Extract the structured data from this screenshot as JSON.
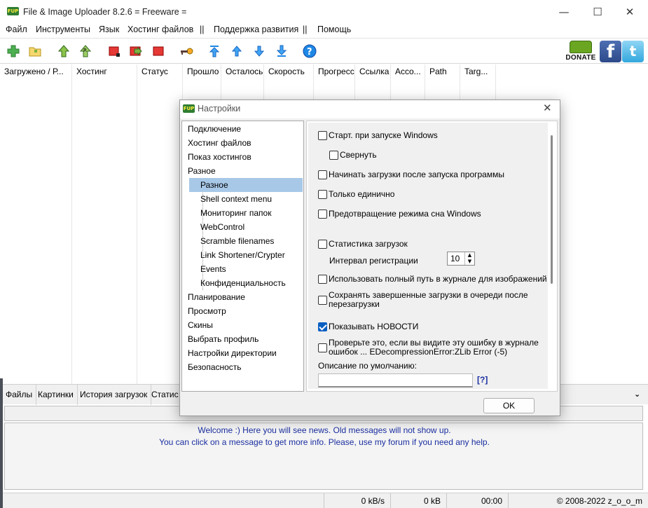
{
  "window": {
    "title": "File & Image Uploader 8.2.6  = Freeware =",
    "app_icon_text": "FUP",
    "minimize": "—",
    "maximize": "☐",
    "close": "✕"
  },
  "menu": {
    "items": [
      "Файл",
      "Инструменты",
      "Язык",
      "Хостинг файлов",
      "||",
      "Поддержка развития",
      "||",
      "Помощь"
    ]
  },
  "toolbar": {
    "icons": [
      "add-icon",
      "open-folder-icon",
      "upload-icon",
      "upload-all-icon",
      "stop-icon",
      "move-icon",
      "stop-all-icon",
      "key-icon",
      "move-top-icon",
      "move-up-icon",
      "move-down-icon",
      "move-bottom-icon",
      "help-icon"
    ],
    "donate_label": "DONATE",
    "facebook_label": "f",
    "twitter_label": "t"
  },
  "columns": [
    "Загружено / Р...",
    "Хостинг",
    "Статус",
    "Прошло",
    "Осталось",
    "Скорость",
    "Прогресс",
    "Ссылка",
    "Acco...",
    "Path",
    "Targ..."
  ],
  "bottom_tabs": [
    "Файлы",
    "Картинки",
    "История загрузок",
    "Статис"
  ],
  "news": {
    "line1": "Welcome :) Here you will see news. Old messages will not show up.",
    "line2": "You can click on a message to get more info. Please, use my forum if you need any help."
  },
  "status_bar": {
    "speed": "0 kB/s",
    "size": "0 kB",
    "time": "00:00",
    "copyright": "© 2008-2022 z_o_o_m"
  },
  "dialog": {
    "title": "Настройки",
    "close": "✕",
    "tree": [
      {
        "label": "Подключение",
        "child": false,
        "selected": false
      },
      {
        "label": "Хостинг файлов",
        "child": false,
        "selected": false
      },
      {
        "label": "Показ хостингов",
        "child": false,
        "selected": false
      },
      {
        "label": "Разное",
        "child": false,
        "selected": false
      },
      {
        "label": "Разное",
        "child": true,
        "selected": true
      },
      {
        "label": "Shell context menu",
        "child": true,
        "selected": false
      },
      {
        "label": "Мониторинг папок",
        "child": true,
        "selected": false
      },
      {
        "label": "WebControl",
        "child": true,
        "selected": false
      },
      {
        "label": "Scramble filenames",
        "child": true,
        "selected": false
      },
      {
        "label": "Link Shortener/Crypter",
        "child": true,
        "selected": false
      },
      {
        "label": "Events",
        "child": true,
        "selected": false
      },
      {
        "label": "Конфиденциальность",
        "child": true,
        "selected": false
      },
      {
        "label": "Планирование",
        "child": false,
        "selected": false
      },
      {
        "label": "Просмотр",
        "child": false,
        "selected": false
      },
      {
        "label": "Скины",
        "child": false,
        "selected": false
      },
      {
        "label": "Выбрать профиль",
        "child": false,
        "selected": false
      },
      {
        "label": "Настройки директории",
        "child": false,
        "selected": false
      },
      {
        "label": "Безопасность",
        "child": false,
        "selected": false
      }
    ],
    "options": {
      "start_with_windows": {
        "label": "Старт. при запуске Windows",
        "checked": false
      },
      "minimize": {
        "label": "Свернуть",
        "checked": false
      },
      "start_uploads_on_launch": {
        "label": "Начинать загрузки после запуска программы",
        "checked": false
      },
      "single_instance": {
        "label": "Только единично",
        "checked": false
      },
      "prevent_sleep": {
        "label": "Предотвращение режима сна Windows",
        "checked": false
      },
      "upload_stats": {
        "label": "Статистика загрузок",
        "checked": false
      },
      "log_full_path": {
        "label": "Использовать полный путь в журнале для изображений",
        "checked": false
      },
      "keep_completed_line1": "Сохранять завершенные загрузки в очереди после",
      "keep_completed_line2": "перезагрузки",
      "keep_completed_checked": false,
      "show_news": {
        "label": "Показывать НОВОСТИ",
        "checked": true
      },
      "check_error_line1": "Проверьте это, если вы видите эту ошибку в журнале",
      "check_error_line2": "ошибок ...  EDecompressionError:ZLib Error (-5)",
      "check_error_checked": false
    },
    "interval_label": "Интервал регистрации",
    "interval_value": "10",
    "default_description_label": "Описание по умолчанию:",
    "default_description_value": "",
    "help_link": "[?]",
    "ok_label": "OK"
  }
}
